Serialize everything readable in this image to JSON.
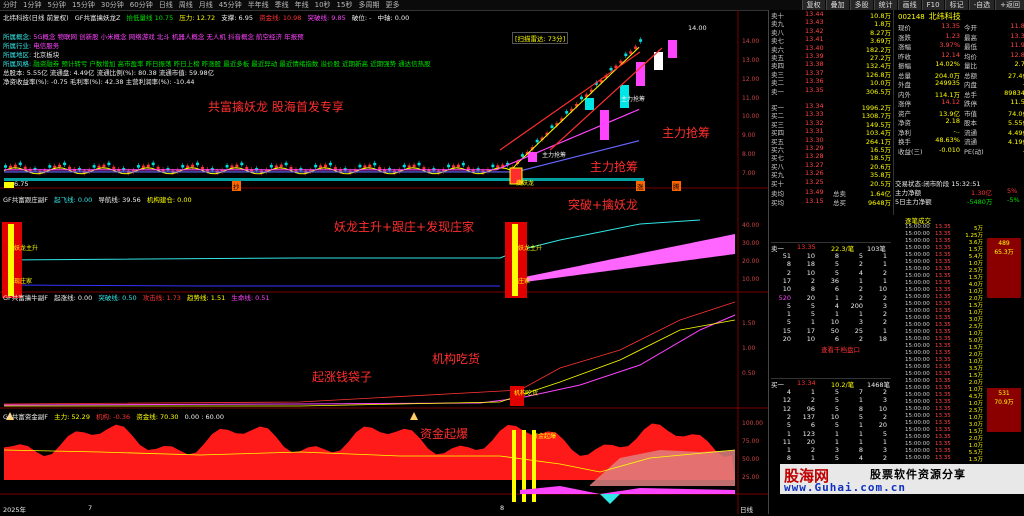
{
  "toolbar": {
    "items": [
      "分时",
      "1分钟",
      "5分钟",
      "15分钟",
      "30分钟",
      "60分钟",
      "日线",
      "周线",
      "月线",
      "45分钟",
      "半年线",
      "季线",
      "年线",
      "10秒",
      "15秒",
      "多周期",
      "更多"
    ],
    "right_buttons": [
      "复权",
      "叠加",
      "多股",
      "统计",
      "画线",
      "F10",
      "标记",
      "-自选",
      "+返回"
    ]
  },
  "main_header": {
    "line1_a": "北纬科技(日线 前复权)",
    "line1_b": "GF共富擒妖龙Z",
    "line1_c": "抬低量线 10.75",
    "line1_d": "压力: 12.72",
    "line1_e": "支撑: 6.95",
    "line1_f": "资金线: 10.98",
    "line1_g": "突破线: 9.85",
    "line1_h": "破位: -",
    "line1_i": "中轴: 0.00",
    "concept_label": "所属概念:",
    "concept_text": "5G概念 物联网 创新股 小米概念 网络游戏 北斗 机器人概念 无人机 抖音概念 航空经济 年报预",
    "industry_label": "所属行业:",
    "industry_text": "电信服务",
    "region_label": "所属地区:",
    "region_text": "北京板块",
    "risk_label": "所属风格:",
    "risk_text": "融资融券 预计转亏 户数增加 高市盈率 昨日振荡 昨日上榜 昨涨股 最近多板 最近异动 最近情绪指数 溢价股 近期新高 近期强势 通达信热股",
    "fin_line1": "总股本: 5.55亿 流通盘: 4.49亿 流通比例(%): 80.38 流通市值: 59.98亿",
    "fin_line2": "净资收益率(%): -0.75 毛利率(%): 42.38 主营利润率(%): -10.44",
    "date_box": "[扫描雷达: 73分]",
    "price_high_label": "14.00",
    "left_low_label": "6.75"
  },
  "annotations": {
    "title": "共富擒妖龙 股海首发专享",
    "main_force1": "主力抢筹",
    "main_force2": "主力抢筹",
    "main_force3": "主力抢筹",
    "yao": "妖龙主升+跟庄+发现庄家",
    "break": "突破+擒妖龙",
    "rise_bag": "起涨钱袋子",
    "inst": "机构吃货",
    "fund": "资金起爆",
    "small_main": "主力抢筹",
    "small_break": "擒妖龙",
    "small_yaozhu": "妖龙主升",
    "small_zhuang": "现庄家",
    "small_yaozhu2": "妖龙主升",
    "small_zhuang2": "庄家",
    "small_inst": "机构吃货",
    "small_fund": "资金起爆",
    "bottom_tag1": "抄",
    "bottom_tag2": "涨",
    "bottom_tag3": "腾"
  },
  "panel2_header": {
    "a": "GF共富跟庄副F",
    "b": "起飞线: 0.00",
    "c": "导航线: 39.56",
    "d": "机构建仓: 0.00"
  },
  "panel3_header": {
    "a": "GF共富擒牛副F",
    "b": "起涨线: 0.00",
    "c": "突破线: 0.50",
    "d": "攻击线: 1.73",
    "e": "趋势线: 1.51",
    "f": "生命线: 0.51"
  },
  "panel4_header": {
    "a": "GF共富资金副F",
    "b": "主力: 52.29",
    "c": "机构: -0.36",
    "d": "资金线: 70.30",
    "e": "0.00 : 60.00"
  },
  "date_axis": {
    "start": "2025年",
    "mid": "7",
    "end": "8"
  },
  "axis_labels": {
    "main": [
      "14.00",
      "13.00",
      "12.00",
      "11.00",
      "10.00",
      "9.00",
      "8.00",
      "7.00"
    ],
    "p2": [
      "40.00",
      "30.00",
      "20.00",
      "10.00"
    ],
    "p3": [
      "1.50",
      "1.00",
      "0.50"
    ],
    "p4": [
      "100.00",
      "75.00",
      "50.00",
      "25.00"
    ],
    "bottom_right": "日线"
  },
  "orderbook": {
    "sells": [
      {
        "label": "卖十",
        "price": "13.44",
        "vol": "10.8万"
      },
      {
        "label": "卖九",
        "price": "13.43",
        "vol": "1.8万"
      },
      {
        "label": "卖八",
        "price": "13.42",
        "vol": "8.27万"
      },
      {
        "label": "卖七",
        "price": "13.41",
        "vol": "3.69万"
      },
      {
        "label": "卖六",
        "price": "13.40",
        "vol": "182.2万"
      },
      {
        "label": "卖五",
        "price": "13.39",
        "vol": "27.2万"
      },
      {
        "label": "卖四",
        "price": "13.38",
        "vol": "132.4万"
      },
      {
        "label": "卖三",
        "price": "13.37",
        "vol": "126.8万"
      },
      {
        "label": "卖二",
        "price": "13.36",
        "vol": "10.0万"
      },
      {
        "label": "卖一",
        "price": "13.35",
        "vol": "306.5万"
      }
    ],
    "buys": [
      {
        "label": "买一",
        "price": "13.34",
        "vol": "1996.2万"
      },
      {
        "label": "买二",
        "price": "13.33",
        "vol": "1308.7万"
      },
      {
        "label": "买三",
        "price": "13.32",
        "vol": "149.5万"
      },
      {
        "label": "买四",
        "price": "13.31",
        "vol": "103.4万"
      },
      {
        "label": "买五",
        "price": "13.30",
        "vol": "264.1万"
      },
      {
        "label": "买六",
        "price": "13.29",
        "vol": "16.5万"
      },
      {
        "label": "买七",
        "price": "13.28",
        "vol": "18.5万"
      },
      {
        "label": "买八",
        "price": "13.27",
        "vol": "20.6万"
      },
      {
        "label": "买九",
        "price": "13.26",
        "vol": "35.8万"
      },
      {
        "label": "买十",
        "price": "13.25",
        "vol": "20.5万"
      }
    ],
    "totals": [
      {
        "label": "卖均",
        "price": "13.49",
        "l2": "总卖",
        "vol": "1.64亿"
      },
      {
        "label": "买均",
        "price": "13.15",
        "l2": "总买",
        "vol": "9648万"
      }
    ]
  },
  "quote": {
    "code": "002148",
    "name": "北纬科技",
    "rows": [
      {
        "l1": "现价",
        "v1": "13.35",
        "l2": "今开",
        "v2": "11.88"
      },
      {
        "l1": "涨跌",
        "v1": "1.23",
        "l2": "最高",
        "v2": "13.35"
      },
      {
        "l1": "涨幅",
        "v1": "3.97%",
        "l2": "最低",
        "v2": "11.91"
      },
      {
        "l1": "昨收",
        "v1": "12.14",
        "l2": "均价",
        "v2": "12.85"
      },
      {
        "l1": "振幅",
        "v1": "14.02%",
        "l2": "量比",
        "v2": "2.73"
      },
      {
        "l1": "总量",
        "v1": "204.0万",
        "l2": "总额",
        "v2": "27.4亿"
      },
      {
        "l1": "外盘",
        "v1": "249935",
        "l2": "内盘",
        "v2": "..."
      },
      {
        "l1": "内外",
        "v1": "114.1万",
        "l2": "总手",
        "v2": "898340"
      },
      {
        "l1": "涨停",
        "v1": "14.12",
        "l2": "跌停",
        "v2": "11.51"
      },
      {
        "l1": "资产",
        "v1": "13.9亿",
        "l2": "市值",
        "v2": "74.0亿"
      },
      {
        "l1": "净资",
        "v1": "2.18",
        "l2": "股本",
        "v2": "5.55亿"
      },
      {
        "l1": "净利",
        "v1": "-..",
        "l2": "流通",
        "v2": "4.49亿"
      },
      {
        "l1": "换手",
        "v1": "48.63%",
        "l2": "流通",
        "v2": "4.19亿"
      },
      {
        "l1": "收益(三)",
        "v1": "-0.010",
        "l2": "PE(动)",
        "v2": "..."
      }
    ],
    "status_label": "交易状态:",
    "status_value": "闭市阶段 15:32:51",
    "main_in_label": "主力净额",
    "main_in_value": "1.30亿",
    "main_in_pct": "5%",
    "five_day_label": "5日主力净额",
    "five_day_value": "-5480万",
    "five_day_pct": "-5%"
  },
  "level2": {
    "sell_head": {
      "label": "卖一",
      "price": "13.35",
      "count": "22.3/笔",
      "num": "103笔"
    },
    "sell_rows": [
      [
        "51",
        "10",
        "8",
        "5",
        "1"
      ],
      [
        "8",
        "18",
        "5",
        "2",
        "1"
      ],
      [
        "2",
        "10",
        "5",
        "4",
        "2"
      ],
      [
        "17",
        "2",
        "36",
        "1",
        "1"
      ],
      [
        "10",
        "8",
        "6",
        "2",
        "10"
      ],
      [
        "520",
        "20",
        "1",
        "2",
        "2"
      ],
      [
        "5",
        "5",
        "4",
        "200",
        "3"
      ],
      [
        "1",
        "5",
        "1",
        "1",
        "2"
      ],
      [
        "5",
        "1",
        "10",
        "3",
        "2"
      ],
      [
        "15",
        "17",
        "50",
        "25",
        "1"
      ],
      [
        "20",
        "10",
        "6",
        "2",
        "18"
      ]
    ],
    "query_label": "查看千档盘口",
    "buy_head": {
      "label": "买一",
      "price": "13.34",
      "count": "10.2/笔",
      "num": "1468笔"
    },
    "buy_rows": [
      [
        "4",
        "1",
        "5",
        "7",
        "2"
      ],
      [
        "12",
        "2",
        "5",
        "1",
        "3"
      ],
      [
        "12",
        "96",
        "5",
        "8",
        "10"
      ],
      [
        "2",
        "137",
        "10",
        "5",
        "2"
      ],
      [
        "5",
        "6",
        "5",
        "1",
        "20"
      ],
      [
        "1",
        "123",
        "1",
        "1",
        "5"
      ],
      [
        "11",
        "20",
        "1",
        "1",
        "1"
      ],
      [
        "1",
        "2",
        "3",
        "8",
        "3"
      ],
      [
        "8",
        "1",
        "5",
        "4",
        "2"
      ],
      [
        "5",
        "2",
        "5",
        "1",
        "3"
      ],
      [
        "2",
        "10",
        "8",
        "12",
        "3"
      ],
      [
        "5",
        "1",
        "1",
        "1",
        "5"
      ]
    ]
  },
  "ticks": {
    "header": "逐笔成交",
    "rows": [
      [
        "15:00:00",
        "13.35",
        "5万"
      ],
      [
        "15:00:00",
        "13.35",
        "1.25万"
      ],
      [
        "15:00:00",
        "13.35",
        "3.6万"
      ],
      [
        "15:00:00",
        "13.35",
        "1.5万"
      ],
      [
        "15:00:00",
        "13.35",
        "5.4万"
      ],
      [
        "15:00:00",
        "13.35",
        "1.0万"
      ],
      [
        "15:00:00",
        "13.35",
        "2.5万"
      ],
      [
        "15:00:00",
        "13.35",
        "1.5万"
      ],
      [
        "15:00:00",
        "13.35",
        "4.0万"
      ],
      [
        "15:00:00",
        "13.35",
        "1.0万"
      ],
      [
        "15:00:00",
        "13.35",
        "2.0万"
      ],
      [
        "15:00:00",
        "13.35",
        "1.5万"
      ],
      [
        "15:00:00",
        "13.35",
        "1.0万"
      ],
      [
        "15:00:00",
        "13.35",
        "3.0万"
      ],
      [
        "15:00:00",
        "13.35",
        "2.5万"
      ],
      [
        "15:00:00",
        "13.35",
        "1.0万"
      ],
      [
        "15:00:00",
        "13.35",
        "5.0万"
      ],
      [
        "15:00:00",
        "13.35",
        "1.5万"
      ],
      [
        "15:00:00",
        "13.35",
        "2.0万"
      ],
      [
        "15:00:00",
        "13.35",
        "1.0万"
      ],
      [
        "15:00:00",
        "13.35",
        "3.5万"
      ],
      [
        "15:00:00",
        "13.35",
        "1.5万"
      ],
      [
        "15:00:00",
        "13.35",
        "2.0万"
      ],
      [
        "15:00:00",
        "13.35",
        "1.0万"
      ],
      [
        "15:00:00",
        "13.35",
        "4.5万"
      ],
      [
        "15:00:00",
        "13.35",
        "1.0万"
      ],
      [
        "15:00:00",
        "13.35",
        "2.5万"
      ],
      [
        "15:00:00",
        "13.35",
        "1.0万"
      ],
      [
        "15:00:00",
        "13.35",
        "3.0万"
      ],
      [
        "15:00:00",
        "13.35",
        "1.5万"
      ],
      [
        "15:00:00",
        "13.35",
        "2.0万"
      ],
      [
        "15:00:00",
        "13.35",
        "1.0万"
      ],
      [
        "15:00:00",
        "13.35",
        "5.5万"
      ],
      [
        "15:00:00",
        "13.35",
        "1.5万"
      ]
    ],
    "big1": "489",
    "big1b": "65.3万",
    "big2": "531",
    "big2b": "70.9万"
  },
  "logo": {
    "cn": "股海网",
    "slogan": "股票软件资源分享",
    "url": "www.Guhai.com.cn"
  },
  "colors": {
    "up": "#ff3333",
    "down": "#00e000",
    "accent": "#ffff00",
    "cyan": "#33e5e5",
    "magenta": "#ff44ff"
  }
}
